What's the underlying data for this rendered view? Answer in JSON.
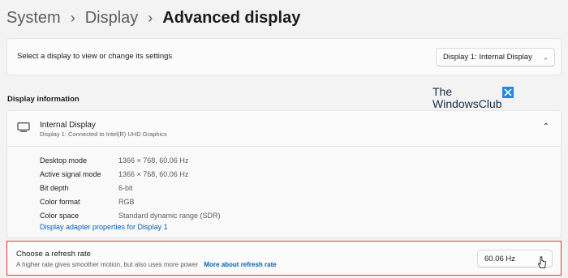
{
  "breadcrumb": {
    "items": [
      "System",
      "Display"
    ],
    "current": "Advanced display",
    "separator": "›"
  },
  "select_display": {
    "label": "Select a display to view or change its settings",
    "selected": "Display 1: Internal Display",
    "chevron": "chevron-down-icon"
  },
  "display_info": {
    "section_title": "Display information",
    "name": "Internal Display",
    "connection": "Display 1: Connected to Intel(R) UHD Graphics",
    "icon": "monitor-icon",
    "rows": [
      {
        "key": "Desktop mode",
        "value": "1366 × 768, 60.06 Hz"
      },
      {
        "key": "Active signal mode",
        "value": "1366 × 768, 60.06 Hz"
      },
      {
        "key": "Bit depth",
        "value": "6-bit"
      },
      {
        "key": "Color format",
        "value": "RGB"
      },
      {
        "key": "Color space",
        "value": "Standard dynamic range (SDR)"
      }
    ],
    "adapter_link": "Display adapter properties for Display 1"
  },
  "refresh_rate": {
    "title": "Choose a refresh rate",
    "description": "A higher rate gives smoother motion, but also uses more power",
    "more_link": "More about refresh rate",
    "selected": "60.06 Hz"
  },
  "watermark": {
    "line1": "The",
    "line2": "WindowsClub"
  },
  "colors": {
    "accent_link": "#005fb8",
    "highlight_border": "#e03a3a",
    "logo_blue": "#1e88e5"
  }
}
